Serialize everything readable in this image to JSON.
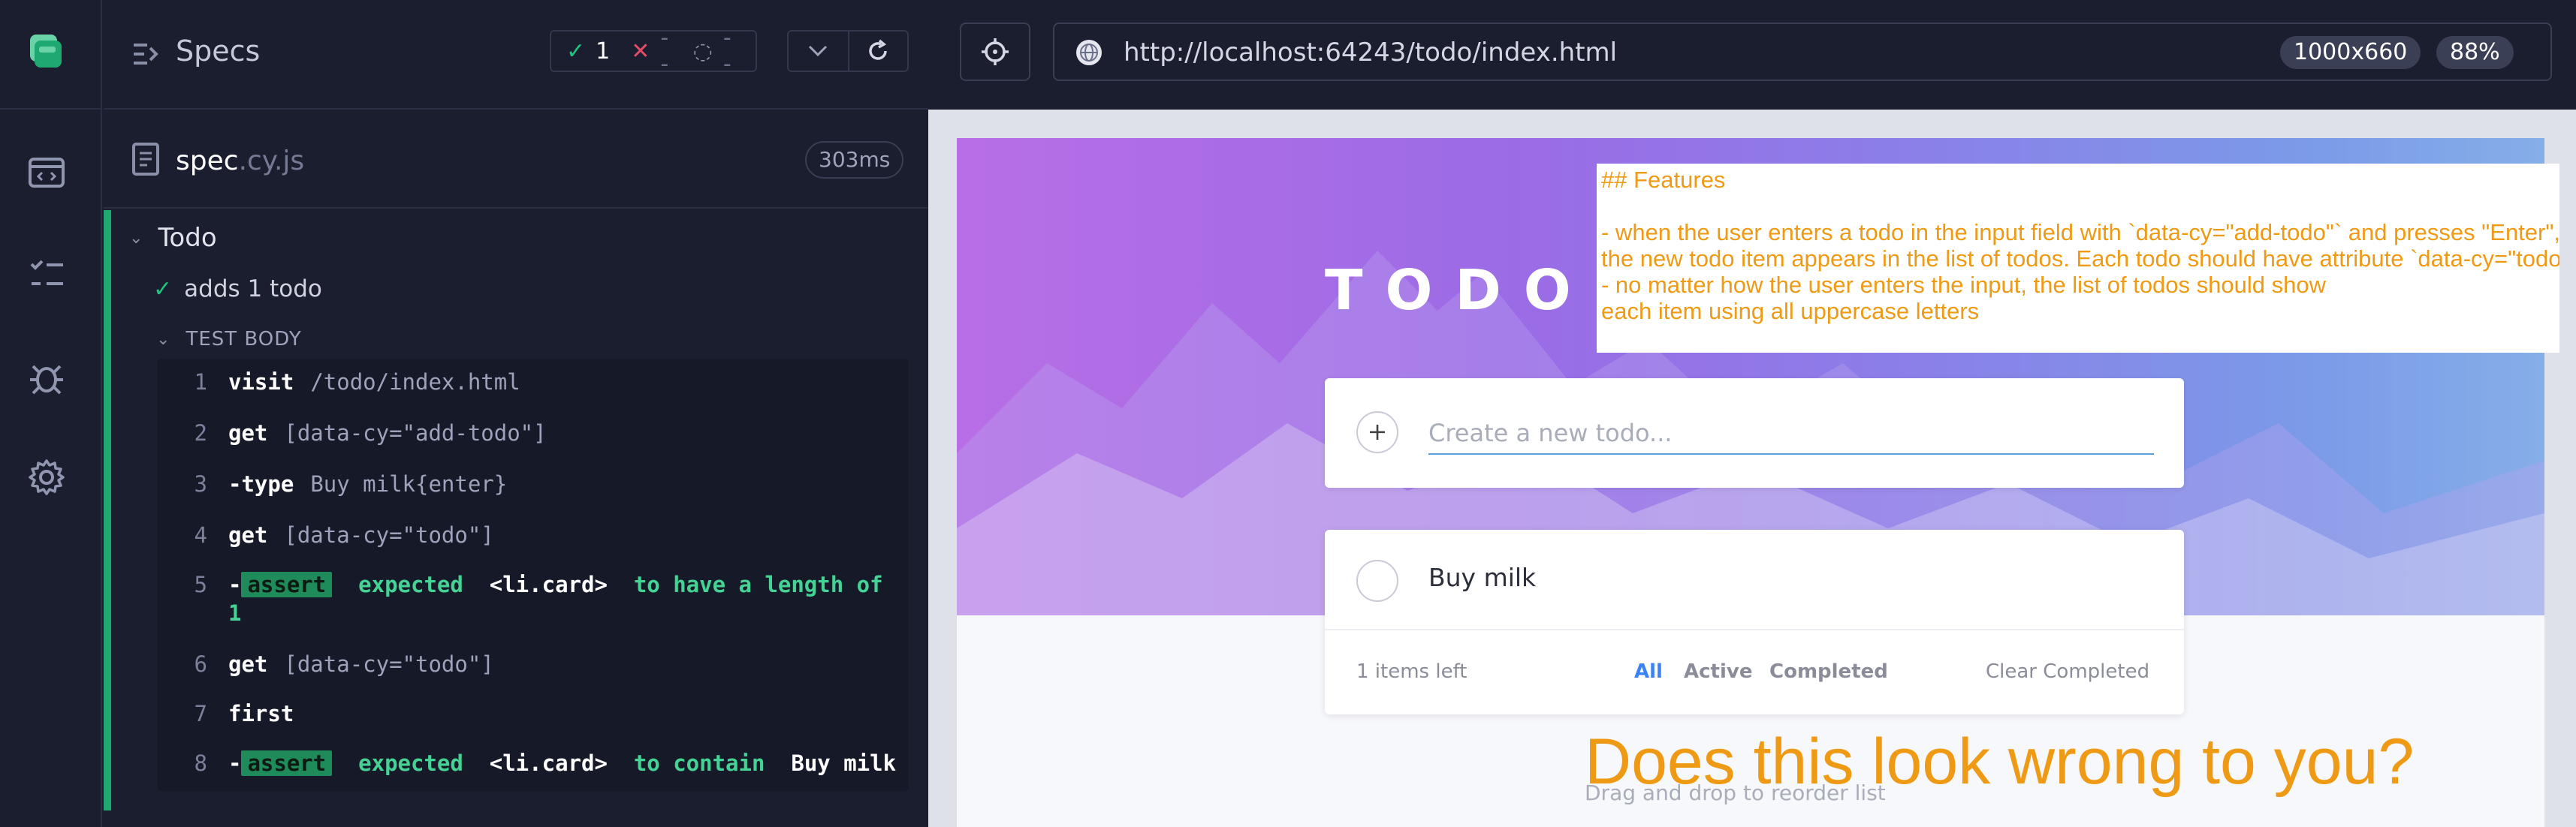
{
  "reporter": {
    "title": "Specs",
    "stats": {
      "passed": "1",
      "failed": "--",
      "pending": "--"
    },
    "spec_file": {
      "base": "spec",
      "ext": ".cy.js",
      "duration": "303ms"
    },
    "suite": "Todo",
    "test": "adds 1 todo",
    "section": "TEST BODY",
    "commands": [
      {
        "num": "1",
        "name": "visit",
        "arg": "/todo/index.html"
      },
      {
        "num": "2",
        "name": "get",
        "arg": "[data-cy=\"add-todo\"]"
      },
      {
        "num": "3",
        "name": "-type",
        "arg": "Buy milk{enter}"
      },
      {
        "num": "4",
        "name": "get",
        "arg": "[data-cy=\"todo\"]"
      },
      {
        "num": "5",
        "prefix": "-",
        "badge": "assert",
        "t1": "expected",
        "t2": "<li.card>",
        "t3": "to have a length of",
        "t4": "1"
      },
      {
        "num": "6",
        "name": "get",
        "arg": "[data-cy=\"todo\"]"
      },
      {
        "num": "7",
        "name": "first",
        "arg": ""
      },
      {
        "num": "8",
        "prefix": "-",
        "badge": "assert",
        "t1": "expected",
        "t2": "<li.card>",
        "t3": "to contain",
        "t4": "Buy milk"
      }
    ]
  },
  "browser": {
    "url": "http://localhost:64243/todo/index.html",
    "viewport": "1000x660",
    "zoom": "88%"
  },
  "app": {
    "title": "TODO",
    "input_placeholder": "Create a new todo...",
    "items": [
      {
        "label": "Buy milk"
      }
    ],
    "items_left": "1 items left",
    "filters": {
      "all": "All",
      "active": "Active",
      "completed": "Completed"
    },
    "clear": "Clear Completed",
    "drag_hint": "Drag and drop to reorder list"
  },
  "overlay": {
    "notes": "## Features\n\n- when the user enters a todo in the input field with `data-cy=\"add-todo\"` and presses \"Enter\",\nthe new todo item appears in the list of todos. Each todo should have attribute `data-cy=\"todo\"`\n- no matter how the user enters the input, the list of todos should show\neach item using all uppercase letters",
    "question": "Does this look wrong to you?"
  },
  "colors": {
    "pass": "#1fc47d",
    "fail": "#e04e6a",
    "accent": "#ef9a14",
    "link": "#3b82f6"
  }
}
